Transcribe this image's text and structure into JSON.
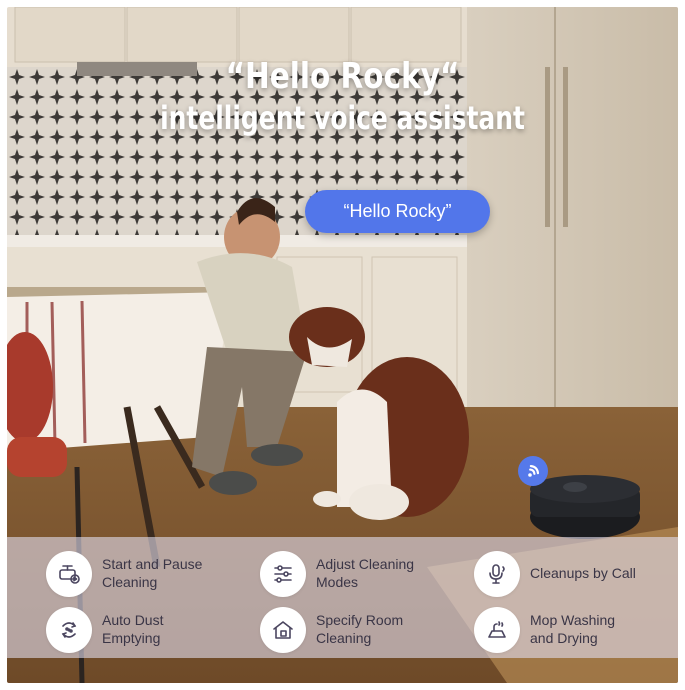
{
  "headline": {
    "line1": "“Hello Rocky“",
    "line2": "intelligent voice assistant"
  },
  "speech_bubble": "“Hello Rocky”",
  "colors": {
    "accent_blue": "#5276ea",
    "panel": "#dedaea",
    "icon_stroke": "#4b4660"
  },
  "features": [
    {
      "label": "Start and Pause\nCleaning",
      "icon": "robot-play-icon"
    },
    {
      "label": "Adjust Cleaning\nModes",
      "icon": "sliders-icon"
    },
    {
      "label": "Cleanups by Call",
      "icon": "microphone-icon"
    },
    {
      "label": "Auto Dust\nEmptying",
      "icon": "dust-recycle-icon"
    },
    {
      "label": "Specify Room\nCleaning",
      "icon": "home-icon"
    },
    {
      "label": "Mop Washing\nand Drying",
      "icon": "mop-wash-icon"
    }
  ]
}
